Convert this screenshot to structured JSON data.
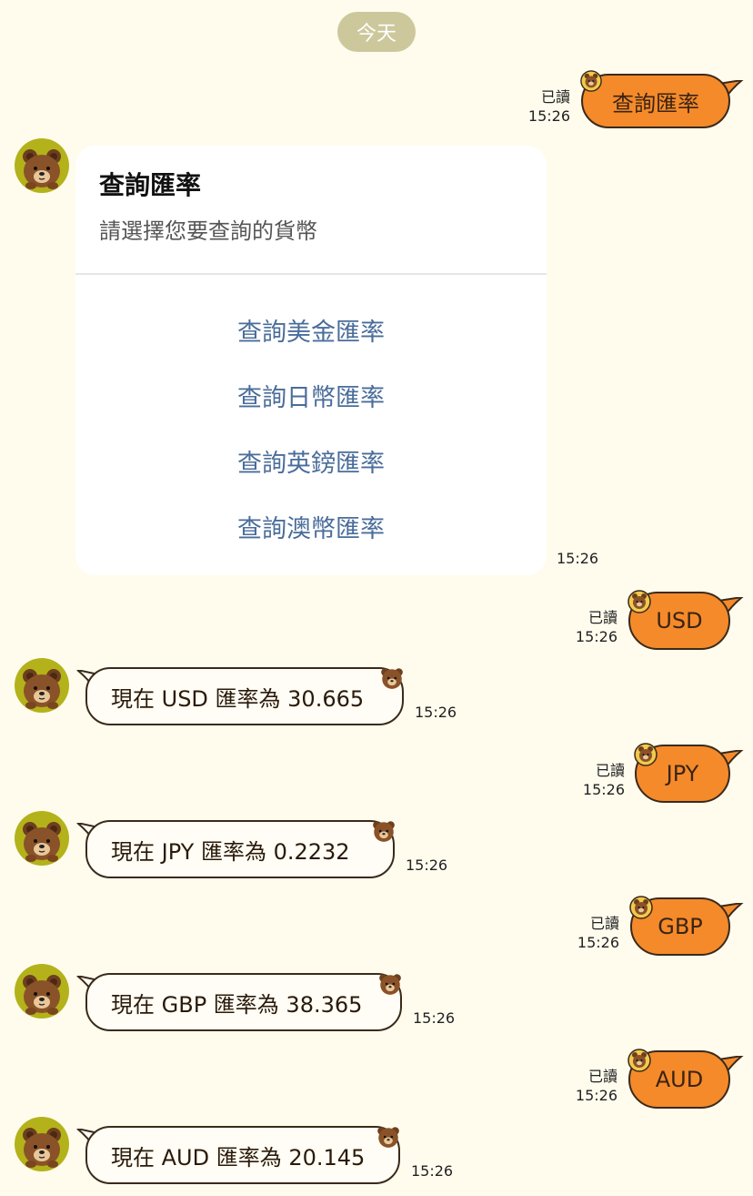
{
  "date_label": "今天",
  "read_label": "已讀",
  "time": "15:26",
  "card": {
    "title": "查詢匯率",
    "subtitle": "請選擇您要查詢的貨幣",
    "actions": [
      "查詢美金匯率",
      "查詢日幣匯率",
      "查詢英鎊匯率",
      "查詢澳幣匯率"
    ]
  },
  "messages": [
    {
      "from": "user",
      "text": "查詢匯率"
    },
    {
      "from": "user",
      "text": "USD"
    },
    {
      "from": "bot",
      "text": "現在 USD 匯率為 30.665"
    },
    {
      "from": "user",
      "text": "JPY"
    },
    {
      "from": "bot",
      "text": "現在 JPY 匯率為 0.2232"
    },
    {
      "from": "user",
      "text": "GBP"
    },
    {
      "from": "bot",
      "text": "現在 GBP 匯率為 38.365"
    },
    {
      "from": "user",
      "text": "AUD"
    },
    {
      "from": "bot",
      "text": "現在 AUD 匯率為 20.145"
    }
  ],
  "colors": {
    "background": "#fffcee",
    "user_bubble": "#f58a2a",
    "bot_bubble": "#fffdf5",
    "outline": "#3a2a1a",
    "action_link": "#4a6d9a",
    "avatar_bg": "#b4b21a"
  },
  "icons": {
    "avatar": "brown-bear-avatar-icon",
    "sticker": "brown-bear-sticker-icon"
  }
}
